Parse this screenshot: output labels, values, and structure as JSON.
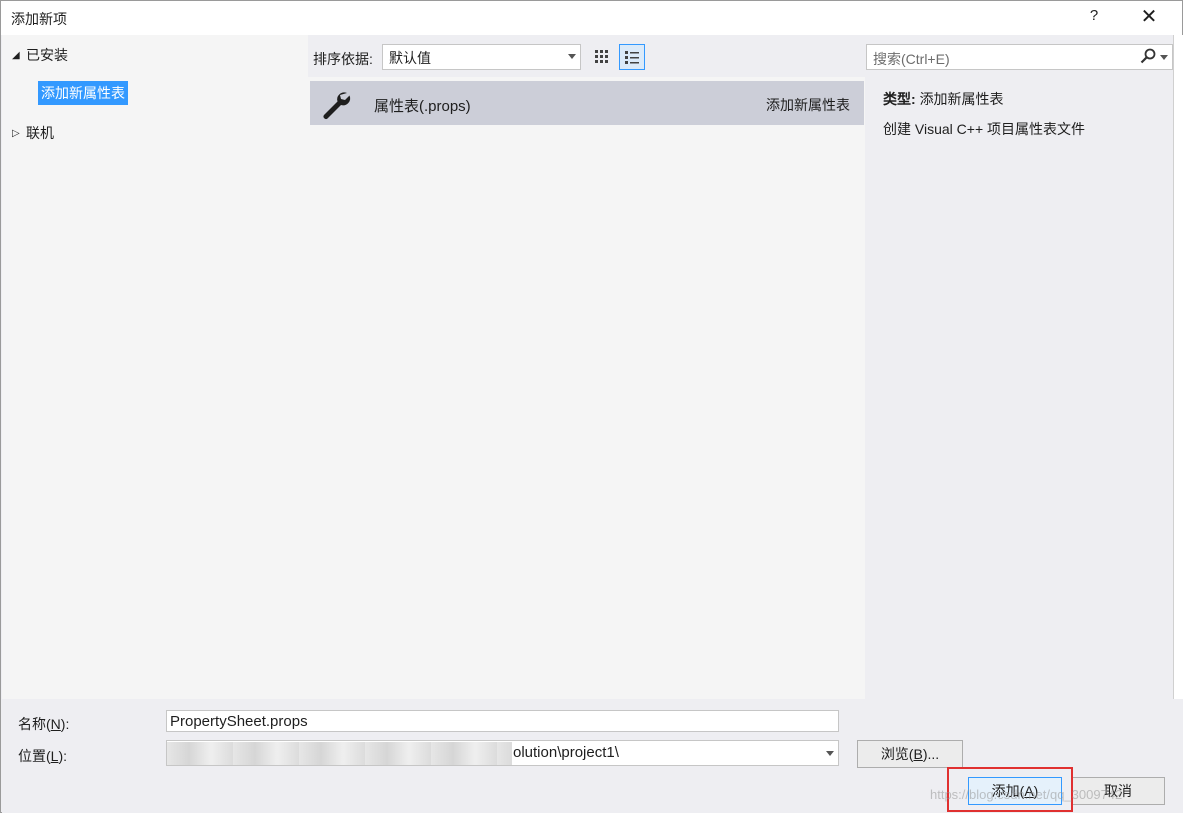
{
  "window": {
    "title": "添加新项",
    "help_label": "?",
    "close_label": "✕"
  },
  "tree": {
    "installed_label": "已安装",
    "selected_item": "添加新属性表",
    "online_label": "联机"
  },
  "toolbar": {
    "sort_label": "排序依据:",
    "sort_value": "默认值"
  },
  "search": {
    "placeholder": "搜索(Ctrl+E)"
  },
  "items": [
    {
      "name": "属性表(.props)",
      "category": "添加新属性表",
      "icon": "wrench-icon"
    }
  ],
  "details": {
    "type_label": "类型:",
    "type_value": "添加新属性表",
    "description": "创建 Visual C++ 项目属性表文件"
  },
  "form": {
    "name_label_prefix": "名称(",
    "name_label_key": "N",
    "name_label_suffix": "):",
    "name_value": "PropertySheet.props",
    "location_label_prefix": "位置(",
    "location_label_key": "L",
    "location_label_suffix": "):",
    "location_value": "olution\\project1\\",
    "browse_prefix": "浏览(",
    "browse_key": "B",
    "browse_suffix": ")...",
    "add_prefix": "添加(",
    "add_key": "A",
    "add_suffix": ")",
    "cancel_label": "取消"
  },
  "watermark": "https://blog.csdn.net/qq_3009742",
  "colors": {
    "selection": "#3399ff",
    "item_highlight": "#ccced8",
    "highlight_box": "#e03030"
  }
}
